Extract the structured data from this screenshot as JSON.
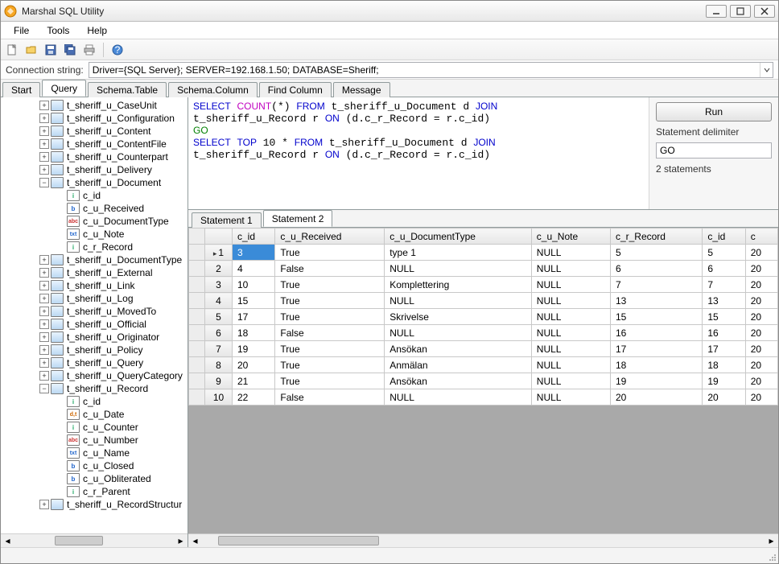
{
  "window": {
    "title": "Marshal SQL Utility"
  },
  "menu": {
    "file": "File",
    "tools": "Tools",
    "help": "Help"
  },
  "toolbar_icons": {
    "new": "new-file-icon",
    "open": "open-folder-icon",
    "save": "save-icon",
    "saveall": "save-all-icon",
    "print": "print-icon",
    "help": "help-icon"
  },
  "connection": {
    "label": "Connection string:",
    "value": "Driver={SQL Server}; SERVER=192.168.1.50; DATABASE=Sheriff;"
  },
  "main_tabs": [
    "Start",
    "Query",
    "Schema.Table",
    "Schema.Column",
    "Find Column",
    "Message"
  ],
  "main_tabs_active": 1,
  "tree": [
    {
      "label": "t_sheriff_u_CaseUnit",
      "expandable": true
    },
    {
      "label": "t_sheriff_u_Configuration",
      "expandable": true
    },
    {
      "label": "t_sheriff_u_Content",
      "expandable": true
    },
    {
      "label": "t_sheriff_u_ContentFile",
      "expandable": true
    },
    {
      "label": "t_sheriff_u_Counterpart",
      "expandable": true
    },
    {
      "label": "t_sheriff_u_Delivery",
      "expandable": true
    },
    {
      "label": "t_sheriff_u_Document",
      "expandable": true,
      "open": true,
      "children": [
        {
          "label": "c_id",
          "icon": "i"
        },
        {
          "label": "c_u_Received",
          "icon": "b"
        },
        {
          "label": "c_u_DocumentType",
          "icon": "abc"
        },
        {
          "label": "c_u_Note",
          "icon": "txt"
        },
        {
          "label": "c_r_Record",
          "icon": "i"
        }
      ]
    },
    {
      "label": "t_sheriff_u_DocumentType",
      "expandable": true
    },
    {
      "label": "t_sheriff_u_External",
      "expandable": true
    },
    {
      "label": "t_sheriff_u_Link",
      "expandable": true
    },
    {
      "label": "t_sheriff_u_Log",
      "expandable": true
    },
    {
      "label": "t_sheriff_u_MovedTo",
      "expandable": true
    },
    {
      "label": "t_sheriff_u_Official",
      "expandable": true
    },
    {
      "label": "t_sheriff_u_Originator",
      "expandable": true
    },
    {
      "label": "t_sheriff_u_Policy",
      "expandable": true
    },
    {
      "label": "t_sheriff_u_Query",
      "expandable": true
    },
    {
      "label": "t_sheriff_u_QueryCategory",
      "expandable": true
    },
    {
      "label": "t_sheriff_u_Record",
      "expandable": true,
      "open": true,
      "children": [
        {
          "label": "c_id",
          "icon": "i"
        },
        {
          "label": "c_u_Date",
          "icon": "dt"
        },
        {
          "label": "c_u_Counter",
          "icon": "i"
        },
        {
          "label": "c_u_Number",
          "icon": "abc"
        },
        {
          "label": "c_u_Name",
          "icon": "txt"
        },
        {
          "label": "c_u_Closed",
          "icon": "b"
        },
        {
          "label": "c_u_Obliterated",
          "icon": "b"
        },
        {
          "label": "c_r_Parent",
          "icon": "i"
        }
      ]
    },
    {
      "label": "t_sheriff_u_RecordStructur",
      "expandable": true
    }
  ],
  "sql_tokens": [
    {
      "t": "SELECT",
      "c": "kw"
    },
    {
      "t": " "
    },
    {
      "t": "COUNT",
      "c": "fn"
    },
    {
      "t": "(*) "
    },
    {
      "t": "FROM",
      "c": "kw"
    },
    {
      "t": " t_sheriff_u_Document d "
    },
    {
      "t": "JOIN",
      "c": "kw"
    },
    {
      "t": "\n"
    },
    {
      "t": "t_sheriff_u_Record r "
    },
    {
      "t": "ON",
      "c": "kw"
    },
    {
      "t": " (d.c_r_Record = r.c_id)\n"
    },
    {
      "t": "GO",
      "c": "go"
    },
    {
      "t": "\n"
    },
    {
      "t": "SELECT",
      "c": "kw"
    },
    {
      "t": " "
    },
    {
      "t": "TOP",
      "c": "kw"
    },
    {
      "t": " 10 * "
    },
    {
      "t": "FROM",
      "c": "kw"
    },
    {
      "t": " t_sheriff_u_Document d "
    },
    {
      "t": "JOIN",
      "c": "kw"
    },
    {
      "t": "\n"
    },
    {
      "t": "t_sheriff_u_Record r "
    },
    {
      "t": "ON",
      "c": "kw"
    },
    {
      "t": " (d.c_r_Record = r.c_id)"
    }
  ],
  "side": {
    "run": "Run",
    "delim_label": "Statement delimiter",
    "delim_value": "GO",
    "count": "2 statements"
  },
  "stmt_tabs": [
    "Statement 1",
    "Statement 2"
  ],
  "stmt_tabs_active": 1,
  "grid": {
    "columns": [
      "c_id",
      "c_u_Received",
      "c_u_DocumentType",
      "c_u_Note",
      "c_r_Record",
      "c_id",
      "c"
    ],
    "rows": [
      [
        "3",
        "True",
        "type 1",
        "NULL",
        "5",
        "5",
        "20"
      ],
      [
        "4",
        "False",
        "NULL",
        "NULL",
        "6",
        "6",
        "20"
      ],
      [
        "10",
        "True",
        "Komplettering",
        "NULL",
        "7",
        "7",
        "20"
      ],
      [
        "15",
        "True",
        "NULL",
        "NULL",
        "13",
        "13",
        "20"
      ],
      [
        "17",
        "True",
        "Skrivelse",
        "NULL",
        "15",
        "15",
        "20"
      ],
      [
        "18",
        "False",
        "NULL",
        "NULL",
        "16",
        "16",
        "20"
      ],
      [
        "19",
        "True",
        "Ansökan",
        "NULL",
        "17",
        "17",
        "20"
      ],
      [
        "20",
        "True",
        "Anmälan",
        "NULL",
        "18",
        "18",
        "20"
      ],
      [
        "21",
        "True",
        "Ansökan",
        "NULL",
        "19",
        "19",
        "20"
      ],
      [
        "22",
        "False",
        "NULL",
        "NULL",
        "20",
        "20",
        "20"
      ]
    ]
  }
}
